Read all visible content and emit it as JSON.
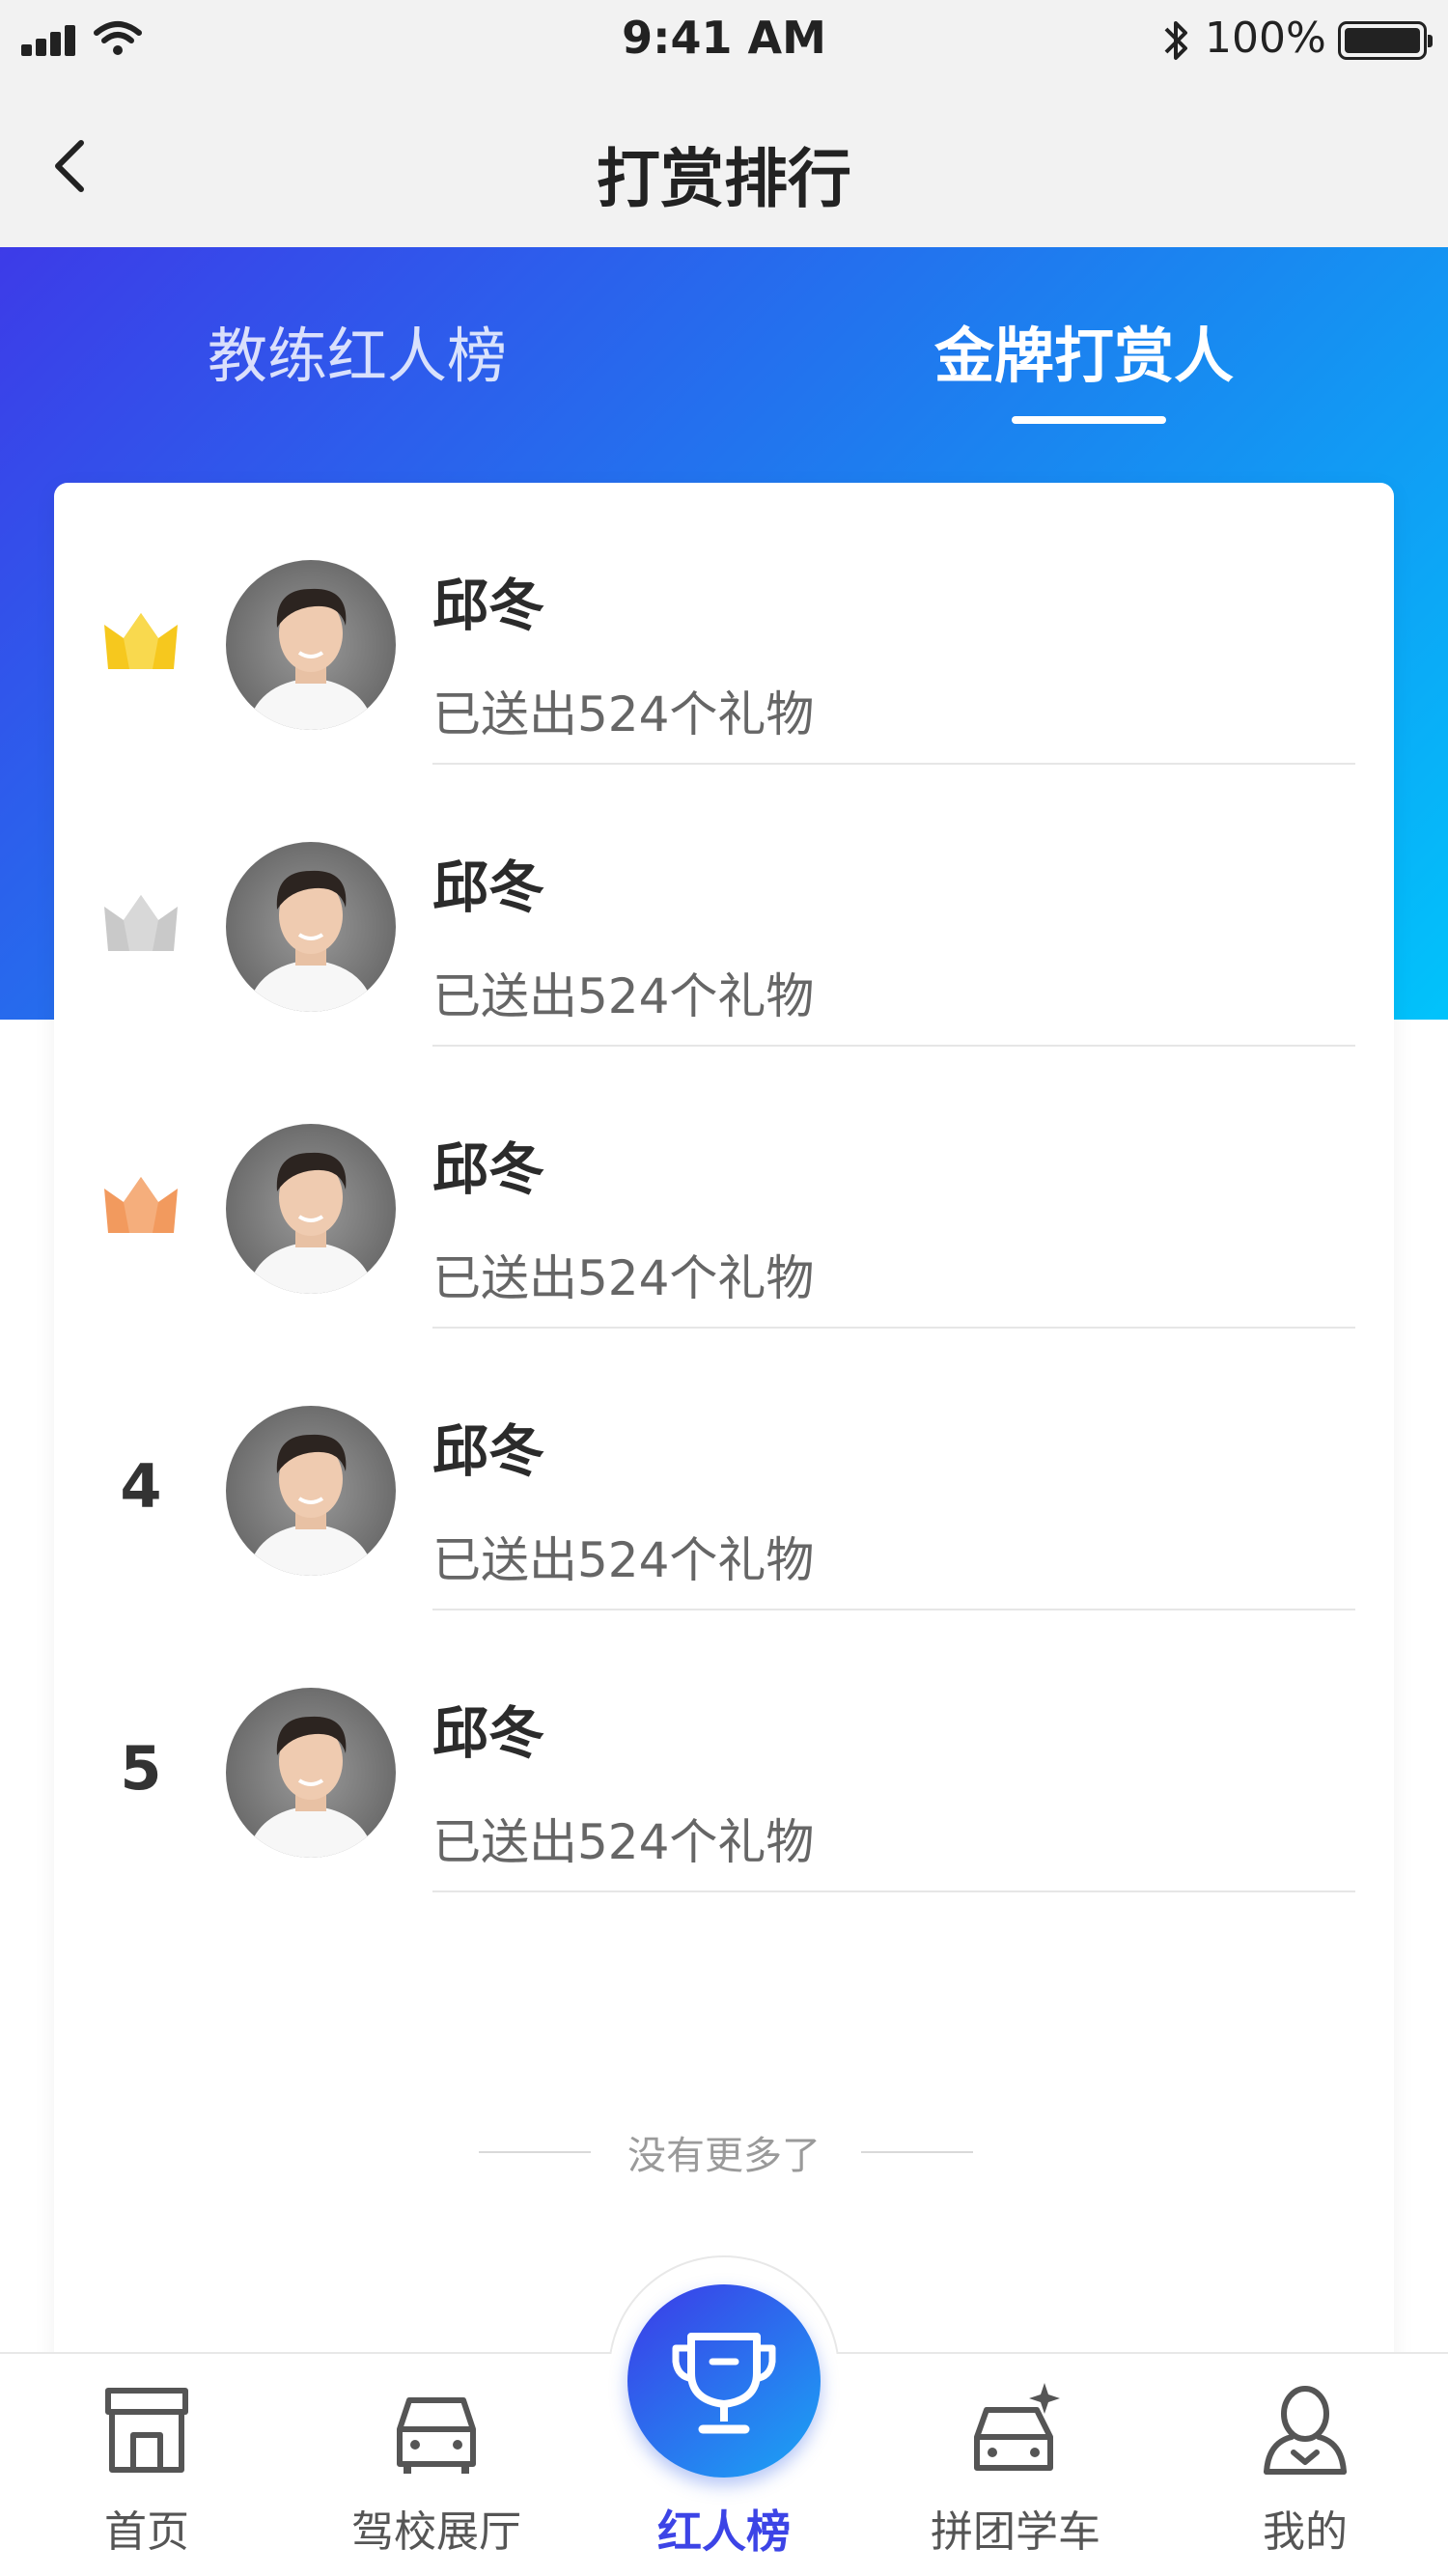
{
  "status_bar": {
    "time": "9:41 AM",
    "battery_percent": "100%"
  },
  "nav": {
    "title": "打赏排行",
    "back_icon": "chevron-left-icon"
  },
  "tabs": [
    {
      "label": "教练红人榜",
      "active": false
    },
    {
      "label": "金牌打赏人",
      "active": true
    }
  ],
  "ranking": [
    {
      "rank": "1",
      "badge": "crown-gold",
      "badge_color": "#F6C81E",
      "name": "邱冬",
      "gift_text": "已送出524个礼物"
    },
    {
      "rank": "2",
      "badge": "crown-silver",
      "badge_color": "#C9C9C9",
      "name": "邱冬",
      "gift_text": "已送出524个礼物"
    },
    {
      "rank": "3",
      "badge": "crown-bronze",
      "badge_color": "#F29A5E",
      "name": "邱冬",
      "gift_text": "已送出524个礼物"
    },
    {
      "rank": "4",
      "badge": "number",
      "name": "邱冬",
      "gift_text": "已送出524个礼物"
    },
    {
      "rank": "5",
      "badge": "number",
      "name": "邱冬",
      "gift_text": "已送出524个礼物"
    }
  ],
  "footer_note": "没有更多了",
  "tab_bar": {
    "items": [
      {
        "label": "首页",
        "icon": "store-icon"
      },
      {
        "label": "驾校展厅",
        "icon": "car-icon"
      },
      {
        "label": "红人榜",
        "icon": "trophy-icon",
        "active": true
      },
      {
        "label": "拼团学车",
        "icon": "car-sparkle-icon"
      },
      {
        "label": "我的",
        "icon": "user-icon"
      }
    ]
  },
  "colors": {
    "accent": "#3C44E6",
    "gradient_start": "#3D3BE8",
    "gradient_end": "#01C3FB",
    "gold": "#F6C81E",
    "silver": "#C9C9C9",
    "bronze": "#F29A5E"
  }
}
